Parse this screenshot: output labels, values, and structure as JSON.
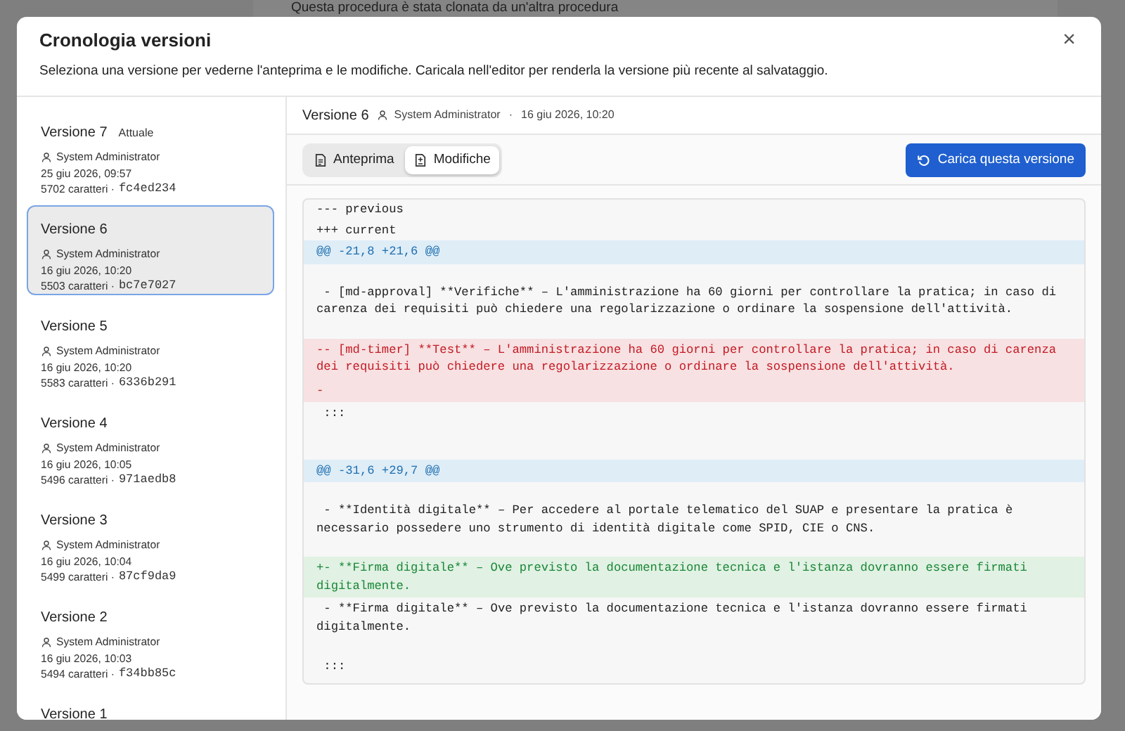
{
  "background": {
    "text": "Questa procedura è stata clonata da un'altra procedura"
  },
  "modal": {
    "title": "Cronologia versioni",
    "subtitle": "Seleziona una versione per vederne l'anteprima e le modifiche. Caricala nell'editor per renderla la versione più recente al salvataggio.",
    "close": "×"
  },
  "versions": [
    {
      "title": "Versione 7",
      "badge": "Attuale",
      "author": "System Administrator",
      "date": "25 giu 2026, 09:57",
      "chars": "5702 caratteri ·",
      "hash": "fc4ed234",
      "selected": false
    },
    {
      "title": "Versione 6",
      "author": "System Administrator",
      "date": "16 giu 2026, 10:20",
      "chars": "5503 caratteri ·",
      "hash": "bc7e7027",
      "selected": true
    },
    {
      "title": "Versione 5",
      "author": "System Administrator",
      "date": "16 giu 2026, 10:20",
      "chars": "5583 caratteri ·",
      "hash": "6336b291",
      "selected": false
    },
    {
      "title": "Versione 4",
      "author": "System Administrator",
      "date": "16 giu 2026, 10:05",
      "chars": "5496 caratteri ·",
      "hash": "971aedb8",
      "selected": false
    },
    {
      "title": "Versione 3",
      "author": "System Administrator",
      "date": "16 giu 2026, 10:04",
      "chars": "5499 caratteri ·",
      "hash": "87cf9da9",
      "selected": false
    },
    {
      "title": "Versione 2",
      "author": "System Administrator",
      "date": "16 giu 2026, 10:03",
      "chars": "5494 caratteri ·",
      "hash": "f34bb85c",
      "selected": false
    },
    {
      "title": "Versione 1",
      "selected": false
    }
  ],
  "detail": {
    "title": "Versione 6",
    "author": "System Administrator",
    "separator": "·",
    "date": "16 giu 2026, 10:20"
  },
  "tabs": [
    {
      "label": "Anteprima",
      "selected": false
    },
    {
      "label": "Modifiche",
      "selected": true
    }
  ],
  "load_button": "Carica questa versione",
  "diff": [
    {
      "kind": "meta",
      "text": "--- previous"
    },
    {
      "kind": "meta",
      "text": "+++ current"
    },
    {
      "kind": "hunk",
      "text": "@@ -21,8 +21,6 @@"
    },
    {
      "kind": "blank"
    },
    {
      "kind": "context",
      "text": " - [md-approval] **Verifiche** – L'amministrazione ha 60 giorni per controllare la pratica; in caso di carenza dei requisiti può chiedere una regolarizzazione o ordinare la sospensione dell'attività."
    },
    {
      "kind": "blank"
    },
    {
      "kind": "removed",
      "text": "-- [md-timer] **Test** – L'amministrazione ha 60 giorni per controllare la pratica; in caso di carenza dei requisiti può chiedere una regolarizzazione o ordinare la sospensione dell'attività."
    },
    {
      "kind": "removed",
      "text": "-"
    },
    {
      "kind": "context",
      "text": " :::"
    },
    {
      "kind": "blank"
    },
    {
      "kind": "blank"
    },
    {
      "kind": "hunk",
      "text": "@@ -31,6 +29,7 @@"
    },
    {
      "kind": "blank"
    },
    {
      "kind": "context",
      "text": " - **Identità digitale** – Per accedere al portale telematico del SUAP e presentare la pratica è necessario possedere uno strumento di identità digitale come SPID, CIE o CNS."
    },
    {
      "kind": "blank"
    },
    {
      "kind": "added",
      "text": "+- **Firma digitale** – Ove previsto la documentazione tecnica e l'istanza dovranno essere firmati digitalmente."
    },
    {
      "kind": "context",
      "text": " - **Firma digitale** – Ove previsto la documentazione tecnica e l'istanza dovranno essere firmati digitalmente."
    },
    {
      "kind": "blank"
    },
    {
      "kind": "context",
      "text": " :::"
    }
  ]
}
